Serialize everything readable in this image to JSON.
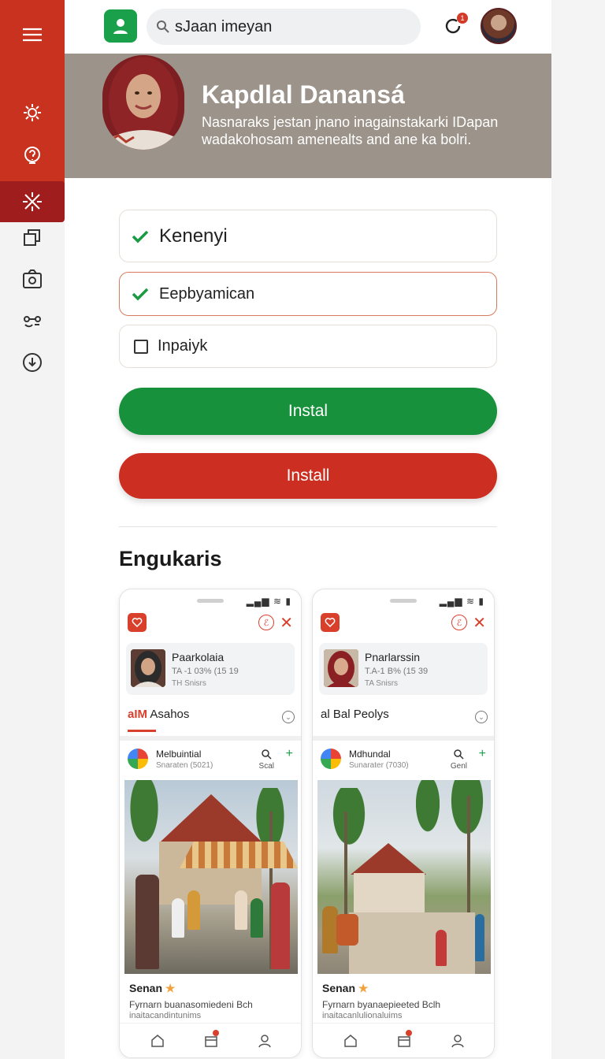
{
  "colors": {
    "rail_red": "#c9321f",
    "rail_active": "#a01d1d",
    "green_button": "#17913c",
    "red_button": "#cc2f22",
    "profile_header": "#9c938a"
  },
  "rail": {
    "items": [
      {
        "icon": "menu-icon"
      },
      {
        "icon": "gear-icon"
      },
      {
        "icon": "help-icon"
      },
      {
        "icon": "tools-icon",
        "active": true
      },
      {
        "icon": "copy-icon"
      },
      {
        "icon": "camera-icon"
      },
      {
        "icon": "link-icon"
      },
      {
        "icon": "download-icon"
      }
    ]
  },
  "topbar": {
    "search_value": "sJaan imeyan",
    "notification_badge": "1"
  },
  "profile": {
    "name": "Kapdlal Danansá",
    "description": "Nasnaraks jestan jnano inagainstakarki IDapan wadakohosam amenealts and ane ka bolri."
  },
  "options": [
    {
      "label": "Kenenyi",
      "checked": true
    },
    {
      "label": "Eepbyamican",
      "checked": true
    },
    {
      "label": "Inpaiyk",
      "checked": false
    }
  ],
  "buttons": {
    "green": "Instal",
    "red": "Install"
  },
  "section_title": "Engukaris",
  "phones": [
    {
      "profile_name": "Paarkolaia",
      "profile_stat": "TA -1 03% (15 19",
      "profile_sub": "TH Snisrs",
      "tab_prefix": "aIM",
      "tab_label": "Asahos",
      "post_name": "Melbuintial",
      "post_sub": "Snaraten (5021)",
      "post_action": "Scal",
      "post_title": "Senan",
      "post_text": "Fyrnarn buanasomiedeni Bch",
      "post_text2": "inaitacandintunims"
    },
    {
      "profile_name": "Pnarlarssin",
      "profile_stat": "T.A-1 B% (15 39",
      "profile_sub": "TA Snisrs",
      "tab_prefix": "",
      "tab_label": "al Bal Peolys",
      "post_name": "Mdhundal",
      "post_sub": "Sunarater (7030)",
      "post_action": "Genl",
      "post_title": "Senan",
      "post_text": "Fyrnarn byanaepieeted Bclh",
      "post_text2": "inaitacanlulionaluims"
    }
  ]
}
